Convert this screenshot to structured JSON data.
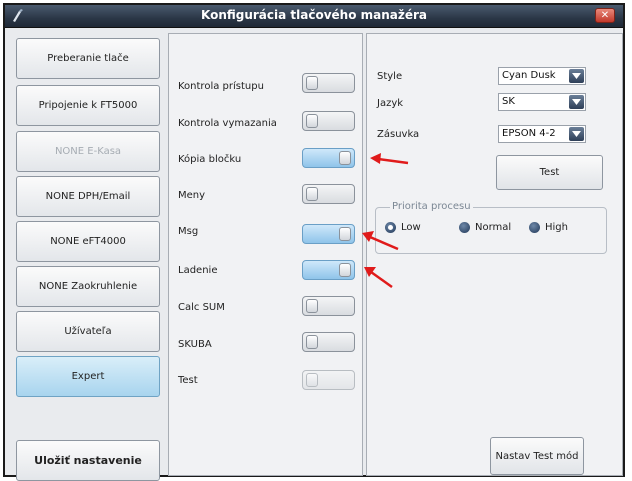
{
  "window": {
    "title": "Konfigurácia tlačového manažéra",
    "close_glyph": "✕"
  },
  "sidebar": {
    "items": [
      {
        "label": "Preberanie tlače",
        "state": "normal"
      },
      {
        "label": "Pripojenie k FT5000",
        "state": "normal"
      },
      {
        "label": "NONE E-Kasa",
        "state": "disabled"
      },
      {
        "label": "NONE DPH/Email",
        "state": "normal"
      },
      {
        "label": "NONE eFT4000",
        "state": "normal"
      },
      {
        "label": "NONE Zaokruhlenie",
        "state": "normal"
      },
      {
        "label": "Užívateľa",
        "state": "normal"
      },
      {
        "label": "Expert",
        "state": "active"
      }
    ],
    "save_label": "Uložiť nastavenie"
  },
  "toggles": [
    {
      "label": "Kontrola prístupu",
      "on": false
    },
    {
      "label": "Kontrola vymazania",
      "on": false
    },
    {
      "label": "Kópia bločku",
      "on": true
    },
    {
      "label": "Meny",
      "on": false
    },
    {
      "label": "Msg",
      "on": true
    },
    {
      "label": "Ladenie",
      "on": true
    },
    {
      "label": "Calc SUM",
      "on": false
    },
    {
      "label": "SKUBA",
      "on": false
    },
    {
      "label": "Test",
      "on": false,
      "disabled": true
    }
  ],
  "settings": {
    "style": {
      "label": "Style",
      "value": "Cyan Dusk"
    },
    "language": {
      "label": "Jazyk",
      "value": "SK"
    },
    "drawer": {
      "label": "Zásuvka",
      "value": "EPSON 4-2"
    },
    "test_button": "Test",
    "priority": {
      "title": "Priorita procesu",
      "options": [
        "Low",
        "Normal",
        "High"
      ],
      "selected": "Low"
    },
    "test_mode_button": "Nastav Test mód"
  },
  "colors": {
    "titlebar": "#2b3747",
    "toggle_on": "#8fc4ea",
    "annotation_arrow": "#e01b1b"
  }
}
